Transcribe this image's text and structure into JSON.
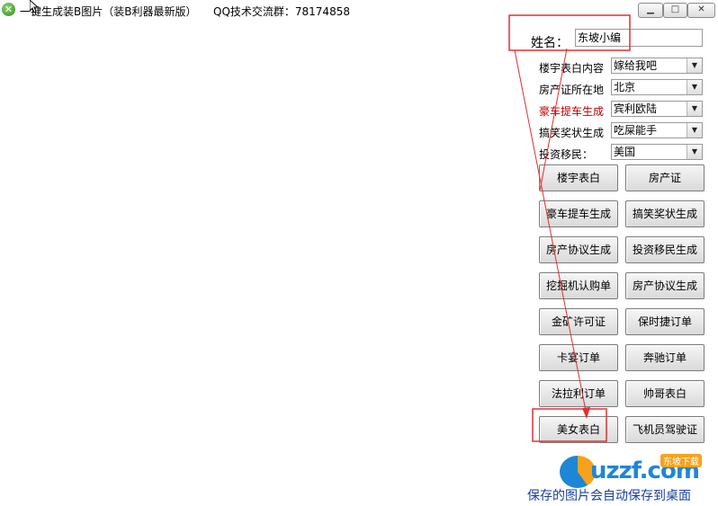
{
  "window": {
    "title": "一键生成装B图片（装B利器最新版）",
    "qq_group": "QQ技术交流群：78174858",
    "min_glyph": "▁",
    "max_glyph": "□",
    "close_glyph": "✕",
    "app_icon_glyph": "✕"
  },
  "form": {
    "name_label": "姓名：",
    "name_value": "东坡小编",
    "rows": [
      {
        "label": "楼宇表白内容",
        "value": "嫁给我吧"
      },
      {
        "label": "房产证所在地",
        "value": "北京"
      },
      {
        "label": "豪车提车生成",
        "value": "宾利欧陆"
      },
      {
        "label": "搞笑奖状生成",
        "value": "吃屎能手"
      },
      {
        "label": "投资移民：",
        "value": "美国"
      }
    ],
    "dropdown_glyph": "▼"
  },
  "buttons": [
    [
      "楼宇表白",
      "房产证"
    ],
    [
      "豪车提车生成",
      "搞笑奖状生成"
    ],
    [
      "房产协议生成",
      "投资移民生成"
    ],
    [
      "挖掘机认购单",
      "房产协议生成"
    ],
    [
      "金矿许可证",
      "保时捷订单"
    ],
    [
      "卡宴订单",
      "奔驰订单"
    ],
    [
      "法拉利订单",
      "帅哥表白"
    ],
    [
      "美女表白",
      "飞机员驾驶证"
    ]
  ],
  "footer": {
    "logo_text": "uzzf.com",
    "logo_badge": "东坡下载",
    "note": "保存的图片会自动保存到桌面"
  },
  "colors": {
    "annotation_red": "#e03030",
    "label_red": "#c00000",
    "footer_blue": "#1a3fa0"
  }
}
